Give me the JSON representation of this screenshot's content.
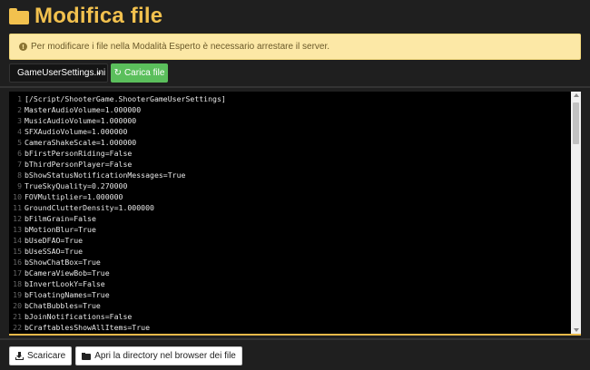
{
  "header": {
    "title": "Modifica file",
    "icon": "folder-icon"
  },
  "alert": {
    "icon": "info-icon",
    "text": "Per modificare i file nella Modalità Esperto è necessario arrestare il server."
  },
  "toolbar": {
    "file_select_value": "GameUserSettings.ini",
    "load_label": "Carica file"
  },
  "editor": {
    "lines": [
      {
        "n": "1",
        "text": "[/Script/ShooterGame.ShooterGameUserSettings]"
      },
      {
        "n": "2",
        "text": "MasterAudioVolume=1.000000"
      },
      {
        "n": "3",
        "text": "MusicAudioVolume=1.000000"
      },
      {
        "n": "4",
        "text": "SFXAudioVolume=1.000000"
      },
      {
        "n": "5",
        "text": "CameraShakeScale=1.000000"
      },
      {
        "n": "6",
        "text": "bFirstPersonRiding=False"
      },
      {
        "n": "7",
        "text": "bThirdPersonPlayer=False"
      },
      {
        "n": "8",
        "text": "bShowStatusNotificationMessages=True"
      },
      {
        "n": "9",
        "text": "TrueSkyQuality=0.270000"
      },
      {
        "n": "10",
        "text": "FOVMultiplier=1.000000"
      },
      {
        "n": "11",
        "text": "GroundClutterDensity=1.000000"
      },
      {
        "n": "12",
        "text": "bFilmGrain=False"
      },
      {
        "n": "13",
        "text": "bMotionBlur=True"
      },
      {
        "n": "14",
        "text": "bUseDFAO=True"
      },
      {
        "n": "15",
        "text": "bUseSSAO=True"
      },
      {
        "n": "16",
        "text": "bShowChatBox=True"
      },
      {
        "n": "17",
        "text": "bCameraViewBob=True"
      },
      {
        "n": "18",
        "text": "bInvertLookY=False"
      },
      {
        "n": "19",
        "text": "bFloatingNames=True"
      },
      {
        "n": "20",
        "text": "bChatBubbles=True"
      },
      {
        "n": "21",
        "text": "bJoinNotifications=False"
      },
      {
        "n": "22",
        "text": "bCraftablesShowAllItems=True"
      }
    ]
  },
  "footer": {
    "download_label": "Scaricare",
    "open_dir_label": "Apri la directory nel browser dei file"
  },
  "colors": {
    "accent": "#f2c14e",
    "alert_bg": "#fce8a6",
    "load_button": "#5bbf5c"
  }
}
